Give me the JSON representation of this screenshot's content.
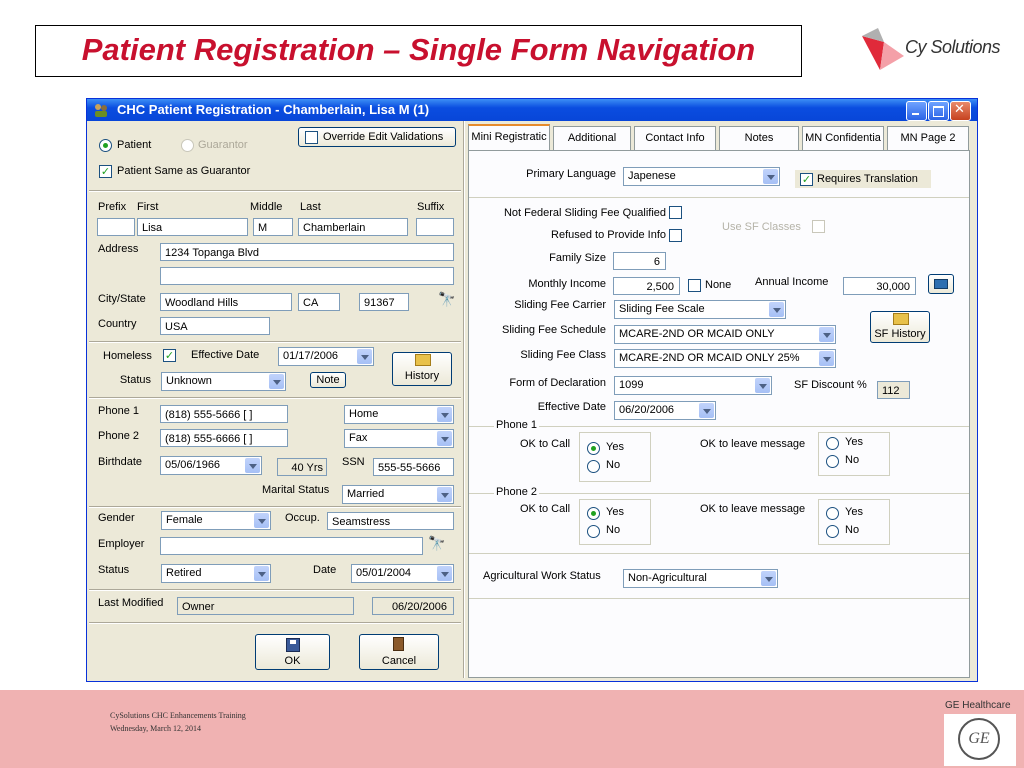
{
  "slide": {
    "title": "Patient Registration – Single Form Navigation",
    "brand_name": "Cy Solutions",
    "footer_line1": "CySolutions CHC Enhancements Training",
    "footer_line2": "Wednesday, March 12, 2014",
    "ge_label": "GE Healthcare",
    "ge_logo_text": "GE"
  },
  "window": {
    "title": "CHC Patient Registration   - Chamberlain,  Lisa M (1)"
  },
  "left": {
    "patient_label": "Patient",
    "guarantor_label": "Guarantor",
    "override_label": "Override Edit Validations",
    "same_as_guarantor_label": "Patient Same as Guarantor",
    "prefix_label": "Prefix",
    "first_label": "First",
    "middle_label": "Middle",
    "last_label": "Last",
    "suffix_label": "Suffix",
    "prefix_value": "",
    "first_value": "Lisa",
    "middle_value": "M",
    "last_value": "Chamberlain",
    "suffix_value": "",
    "address_label": "Address",
    "address1": "1234 Topanga Blvd",
    "address2": "",
    "citystate_label": "City/State",
    "city": "Woodland Hills",
    "state": "CA",
    "zip": "91367",
    "country_label": "Country",
    "country": "USA",
    "homeless_label": "Homeless",
    "effective_date_label": "Effective Date",
    "effective_date": "01/17/2006",
    "status_label": "Status",
    "status_value": "Unknown",
    "note_button": "Note",
    "history_button": "History",
    "phone1_label": "Phone 1",
    "phone1_value": "(818) 555-5666 [    ]",
    "phone1_type": "Home",
    "phone2_label": "Phone 2",
    "phone2_value": "(818) 555-6666 [    ]",
    "phone2_type": "Fax",
    "birthdate_label": "Birthdate",
    "birthdate": "05/06/1966",
    "age": "40 Yrs",
    "ssn_label": "SSN",
    "ssn": "555-55-5666",
    "marital_label": "Marital Status",
    "marital_value": "Married",
    "gender_label": "Gender",
    "gender_value": "Female",
    "occup_label": "Occup.",
    "occup_value": "Seamstress",
    "employer_label": "Employer",
    "employer_value": "",
    "emp_status_label": "Status",
    "emp_status_value": "Retired",
    "date_label": "Date",
    "date_value": "05/01/2004",
    "last_modified_label": "Last Modified",
    "last_modified_by": "Owner",
    "last_modified_date": "06/20/2006",
    "ok_button": "OK",
    "cancel_button": "Cancel"
  },
  "tabs": [
    {
      "label": "Mini Registratic"
    },
    {
      "label": "Additional"
    },
    {
      "label": "Contact Info"
    },
    {
      "label": "Notes"
    },
    {
      "label": "MN Confidentia"
    },
    {
      "label": "MN Page 2"
    }
  ],
  "right": {
    "primary_language_label": "Primary Language",
    "primary_language": "Japenese",
    "requires_translation_label": "Requires Translation",
    "not_federal_label": "Not Federal Sliding Fee Qualified",
    "refused_label": "Refused to Provide Info",
    "use_sf_classes_label": "Use SF Classes",
    "family_size_label": "Family Size",
    "family_size": "6",
    "monthly_income_label": "Monthly Income",
    "monthly_income": "2,500",
    "none_label": "None",
    "annual_income_label": "Annual Income",
    "annual_income": "30,000",
    "sf_carrier_label": "Sliding Fee Carrier",
    "sf_carrier": "Sliding Fee Scale",
    "sf_schedule_label": "Sliding Fee Schedule",
    "sf_schedule": "MCARE-2ND OR MCAID ONLY",
    "sf_class_label": "Sliding Fee Class",
    "sf_class": "MCARE-2ND OR MCAID ONLY 25%",
    "sf_history_button": "SF History",
    "form_decl_label": "Form of Declaration",
    "form_decl": "1099",
    "sf_discount_label": "SF Discount %",
    "sf_discount": "112",
    "effective_date_label": "Effective Date",
    "effective_date": "06/20/2006",
    "phone1_group": "Phone 1",
    "phone2_group": "Phone 2",
    "ok_to_call_label": "OK to Call",
    "ok_to_leave_label": "OK to leave message",
    "yes_label": "Yes",
    "no_label": "No",
    "ag_work_label": "Agricultural Work Status",
    "ag_work_value": "Non-Agricultural"
  },
  "colors": {
    "title_red": "#c8102e",
    "titlebar_blue": "#0a4de0",
    "window_bg": "#ece9d8",
    "footer_pink": "#f0b2b2",
    "tab_accent": "#e68b2c"
  }
}
